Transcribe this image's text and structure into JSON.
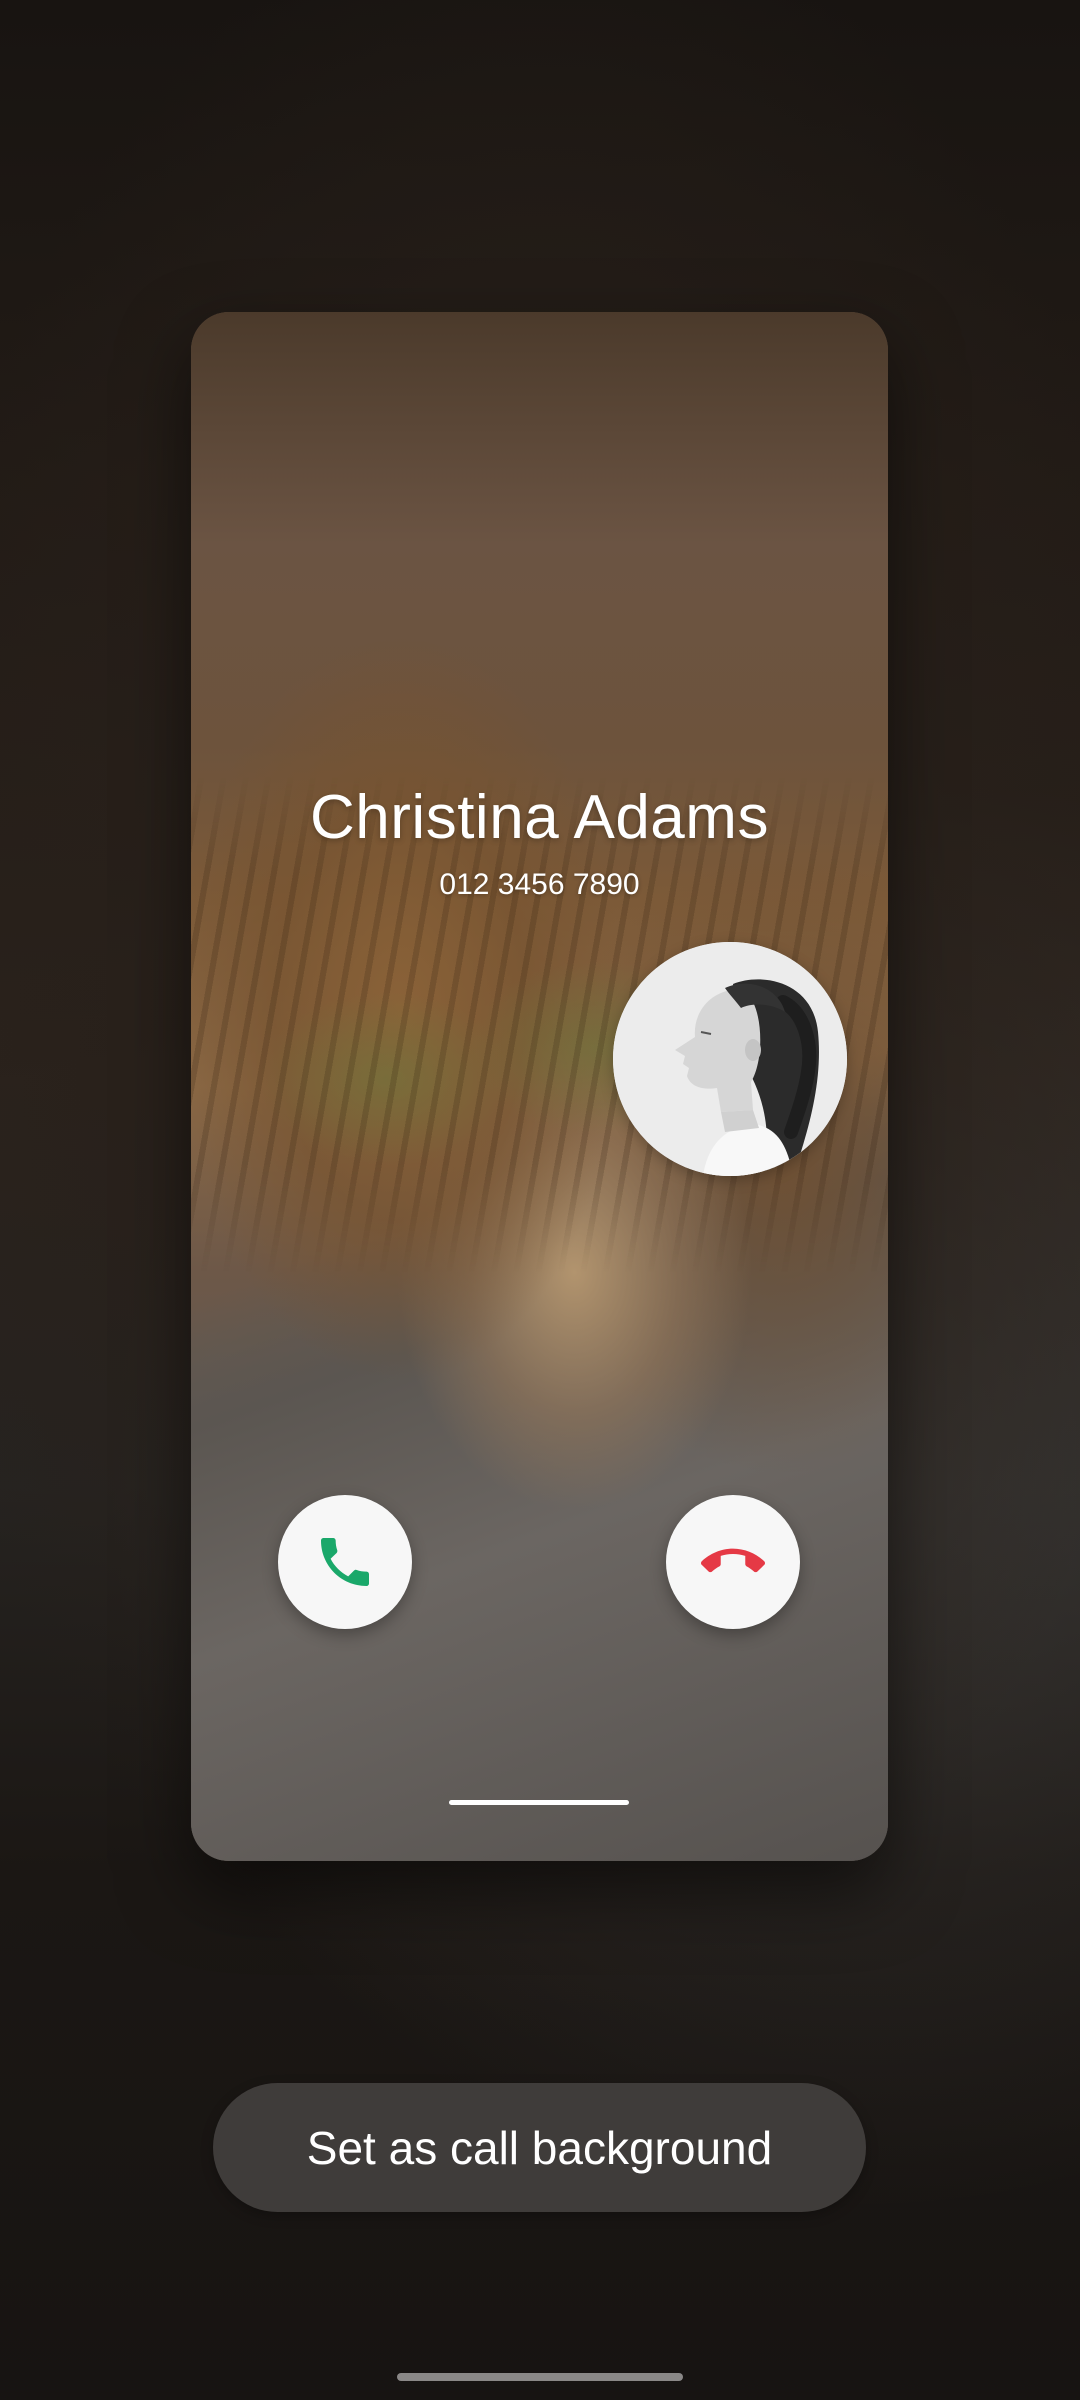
{
  "preview": {
    "contact_name": "Christina Adams",
    "contact_number": "012 3456 7890",
    "avatar_icon": "contact-photo-girl-profile",
    "accept_icon": "phone-icon",
    "decline_icon": "phone-hangup-icon"
  },
  "actions": {
    "set_background_label": "Set as call background"
  },
  "colors": {
    "accept": "#1aa86a",
    "decline": "#e53945",
    "button_bg": "#3f3c3a",
    "text": "#ffffff"
  }
}
